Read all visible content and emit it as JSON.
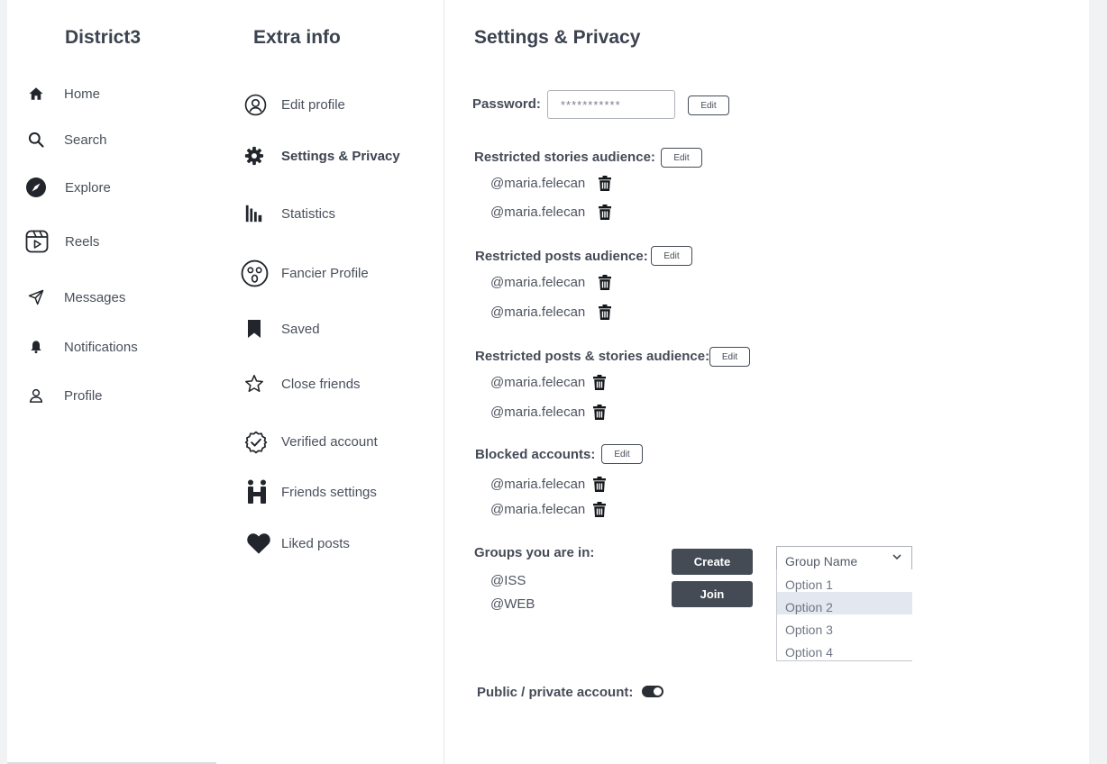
{
  "sidebar": {
    "brand": "District3",
    "items": [
      {
        "label": "Home",
        "icon": "home-icon"
      },
      {
        "label": "Search",
        "icon": "search-icon"
      },
      {
        "label": "Explore",
        "icon": "compass-icon"
      },
      {
        "label": "Reels",
        "icon": "reels-icon"
      },
      {
        "label": "Messages",
        "icon": "send-icon"
      },
      {
        "label": "Notifications",
        "icon": "bell-icon"
      },
      {
        "label": "Profile",
        "icon": "user-icon"
      }
    ]
  },
  "extra": {
    "title": "Extra info",
    "items": [
      {
        "label": "Edit profile",
        "icon": "user-circle-icon"
      },
      {
        "label": "Settings & Privacy",
        "icon": "gear-icon"
      },
      {
        "label": "Statistics",
        "icon": "bar-chart-icon"
      },
      {
        "label": "Fancier Profile",
        "icon": "face-icon"
      },
      {
        "label": "Saved",
        "icon": "bookmark-icon"
      },
      {
        "label": "Close friends",
        "icon": "star-icon"
      },
      {
        "label": "Verified account",
        "icon": "verified-badge-icon"
      },
      {
        "label": "Friends settings",
        "icon": "friends-icon"
      },
      {
        "label": "Liked posts",
        "icon": "heart-icon"
      }
    ]
  },
  "settings": {
    "title": "Settings & Privacy",
    "password_label": "Password:",
    "password_value": "***********",
    "edit_label": "Edit",
    "sections": [
      {
        "label": "Restricted stories audience:",
        "users": [
          "@maria.felecan",
          "@maria.felecan"
        ]
      },
      {
        "label": "Restricted posts audience:",
        "users": [
          "@maria.felecan",
          "@maria.felecan"
        ]
      },
      {
        "label": "Restricted posts & stories audience:",
        "users": [
          "@maria.felecan",
          "@maria.felecan"
        ]
      },
      {
        "label": "Blocked accounts:",
        "users": [
          "@maria.felecan",
          "@maria.felecan"
        ]
      }
    ],
    "groups": {
      "label": "Groups you are in:",
      "items": [
        "@ISS",
        "@WEB"
      ],
      "create_label": "Create",
      "join_label": "Join",
      "dropdown_placeholder": "Group Name",
      "options": [
        "Option 1",
        "Option 2",
        "Option 3",
        "Option 4"
      ],
      "selected_option": "Option 2"
    },
    "privacy_label": "Public / private account:",
    "privacy_toggle_on": true
  }
}
